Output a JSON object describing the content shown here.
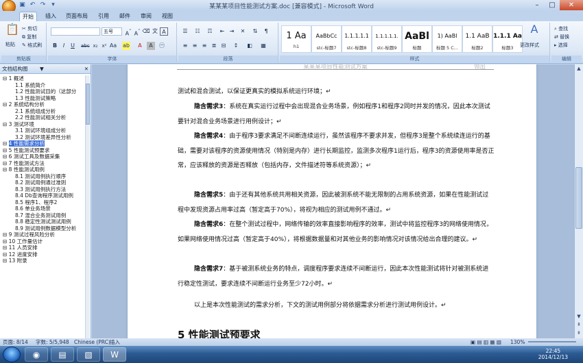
{
  "window": {
    "title": "某某某项目性能测试方案.doc [兼容模式] - Microsoft Word"
  },
  "tabs": [
    "开始",
    "插入",
    "页面布局",
    "引用",
    "邮件",
    "审阅",
    "视图"
  ],
  "ribbon": {
    "clipboard": {
      "paste": "粘贴",
      "cut": "剪切",
      "copy": "复制",
      "format_painter": "格式刷",
      "label": "剪贴板"
    },
    "font": {
      "size": "五号",
      "label": "字体"
    },
    "paragraph": {
      "label": "段落"
    },
    "styles": {
      "label": "样式",
      "items": [
        {
          "sample": "1 Aa",
          "name": "h1"
        },
        {
          "sample": "AaBbCc",
          "name": "stc-标题7"
        },
        {
          "sample": "1.1.1.1.1",
          "name": "stc-标题8"
        },
        {
          "sample": "1.1.1.1.1.",
          "name": "stc-标题9"
        },
        {
          "sample": "AaBl",
          "name": "标题"
        },
        {
          "sample": "1) AaBl",
          "name": "标题 5 C..."
        },
        {
          "sample": "1.1 AaB",
          "name": "标题2"
        },
        {
          "sample": "1.1.1 Aa",
          "name": "标题3"
        }
      ],
      "change_styles": "更改样式"
    },
    "editing": {
      "find": "查找",
      "replace": "替换",
      "select": "选择",
      "label": "编辑"
    }
  },
  "docmap": {
    "title": "文档结构图",
    "items": [
      {
        "text": "1 概述",
        "level": 1
      },
      {
        "text": "1.1 系统简介",
        "level": 2
      },
      {
        "text": "1.2 性能测试目的（这部分",
        "level": 2
      },
      {
        "text": "1.3 性能测试策略",
        "level": 2
      },
      {
        "text": "2 系统结构分析",
        "level": 1
      },
      {
        "text": "2.1 系统组成分析",
        "level": 2
      },
      {
        "text": "2.2 性能测试相关分析",
        "level": 2
      },
      {
        "text": "3 测试环境",
        "level": 1
      },
      {
        "text": "3.1 测试环境组成分析",
        "level": 2
      },
      {
        "text": "3.2 测试环境差异性分析",
        "level": 2
      },
      {
        "text": "4 性能需求分析",
        "level": 1,
        "selected": true
      },
      {
        "text": "5 性能测试预要求",
        "level": 1
      },
      {
        "text": "6 测试工具及数据采集",
        "level": 1
      },
      {
        "text": "7 性能测试方法",
        "level": 1
      },
      {
        "text": "8 性能测试用例",
        "level": 1
      },
      {
        "text": "8.1 测试用例执行顺序",
        "level": 2
      },
      {
        "text": "8.2 测试用例通过准则",
        "level": 2
      },
      {
        "text": "8.3 测试用例执行方法",
        "level": 2
      },
      {
        "text": "8.4 Db查询程序测试用例",
        "level": 2
      },
      {
        "text": "8.5 程序1、程序2",
        "level": 2
      },
      {
        "text": "8.6 单业务场景",
        "level": 2
      },
      {
        "text": "8.7 混合业务测试用例",
        "level": 2
      },
      {
        "text": "8.8 稳定性测试测试用例",
        "level": 2
      },
      {
        "text": "8.9 测试用例数据模型分析",
        "level": 2
      },
      {
        "text": "9 测试过程风险分析",
        "level": 1
      },
      {
        "text": "10 工作量估计",
        "level": 1
      },
      {
        "text": "11 人员安排",
        "level": 1
      },
      {
        "text": "12 进度安排",
        "level": 1
      },
      {
        "text": "13 附录",
        "level": 1
      }
    ]
  },
  "document": {
    "header_text": "某某某项目性能测试方案",
    "header_right": "领出",
    "lines": [
      {
        "text": "测试和混合测试，以保证更真实的模拟系统运行环境；"
      },
      {
        "bold": "隐含需求3",
        "text": "：系统在真实运行过程中会出现混合业务场景，例如程序1和程序2同时并发的情况，因此本次测试要针对混合业务场景进行用例设计；"
      },
      {
        "bold": "隐含需求4",
        "text": "：由于程序3要求满足不间断连续运行，虽然该程序不要求并发，但程序3是整个系统续连运行的基础，需要对该程序的资源使用情况（特别是内存）进行长期监控，监测多次程序1运行后，程序3的资源使用率是否正常，应该释放的资源是否释放（包括内存，文件描述符等系统资源）；"
      },
      {
        "bold": "隐含需求5",
        "text": "：由于还有其他系统共用相关资源，因此被测系统不能无限制的占用系统资源，如果在性能测试过程中发现资源占用率过高（暂定高于70%），将视为相应的测试用例不通过。"
      },
      {
        "bold": "隐含需求6",
        "text": "：在整个测试过程中，网络传输的效率直接影响程序的效率，测试中将监控程序3的网络使用情况，如果网络使用情况过高（暂定高于40%），将根据数据量和对其他业务的影响情况对该情况给出合理的建议。"
      },
      {
        "bold": "隐含需求7",
        "text": "：基于被测系统业务的特点，调度程序要求连续不间断运行，因此本次性能测试将针对被测系统进行稳定性测试，要求连续不间断运行业务至少72小时。"
      },
      {
        "text": "以上是本次性能测试的需求分析，下文的测试用例部分将依据需求分析进行测试用例设计。"
      }
    ],
    "next_heading": "5 性能测试预要求"
  },
  "status": {
    "page": "页面: 8/14",
    "words": "字数: 5/5,948",
    "language": "Chinese (PRC)",
    "mode": "插入",
    "zoom": "130%"
  },
  "clock": {
    "time": "22:45",
    "date": "2014/12/13"
  }
}
